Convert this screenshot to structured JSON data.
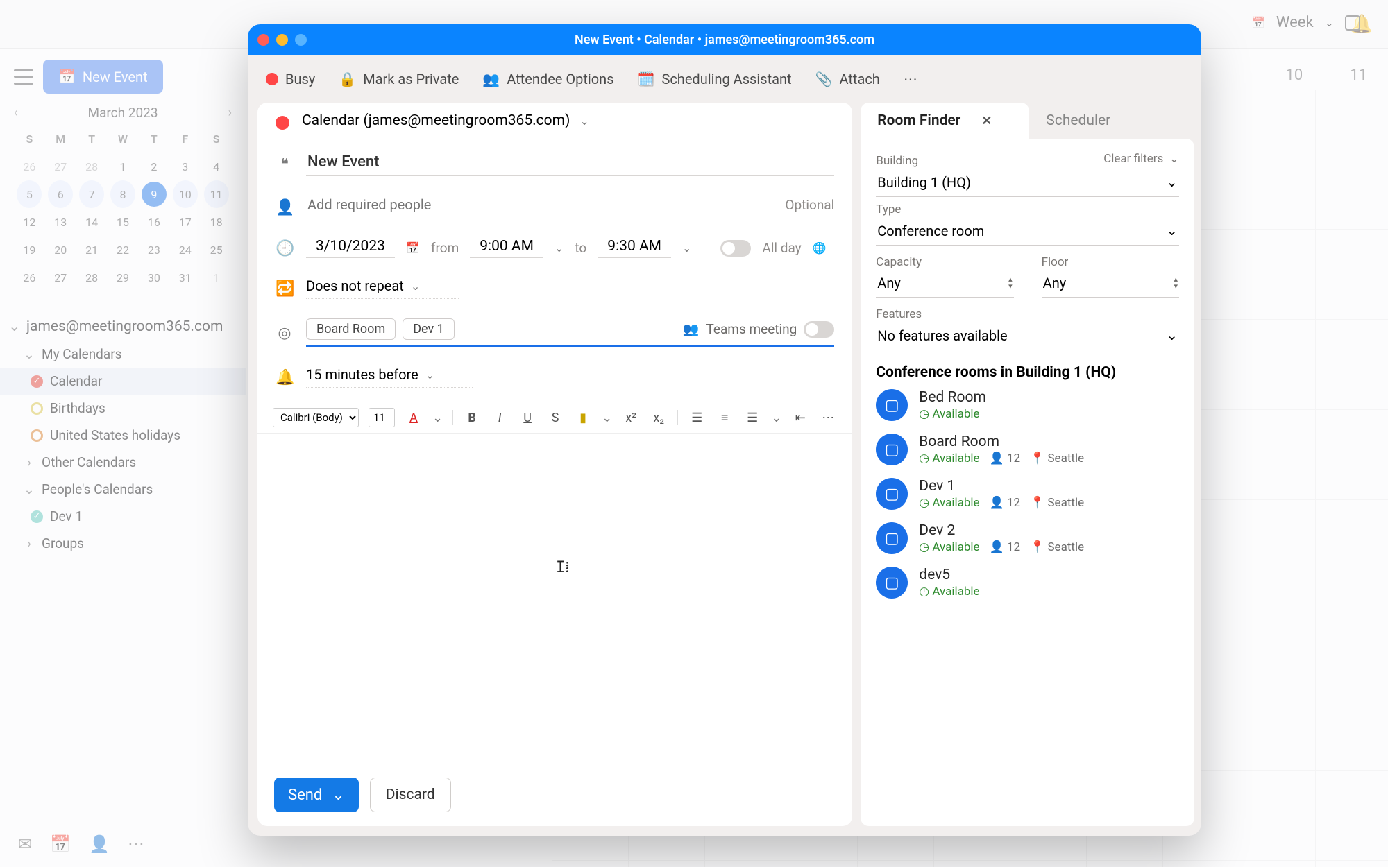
{
  "accent_color": "#1a6fe8",
  "bg_header": {
    "view_label": "Week"
  },
  "sidebar": {
    "new_event": "New Event",
    "month_title": "March 2023",
    "dows": [
      "S",
      "M",
      "T",
      "W",
      "T",
      "F",
      "S"
    ],
    "cells": [
      {
        "v": "26",
        "m": true
      },
      {
        "v": "27",
        "m": true
      },
      {
        "v": "28",
        "m": true
      },
      {
        "v": "1"
      },
      {
        "v": "2"
      },
      {
        "v": "3"
      },
      {
        "v": "4"
      },
      {
        "v": "5",
        "w": true
      },
      {
        "v": "6",
        "w": true
      },
      {
        "v": "7",
        "w": true
      },
      {
        "v": "8",
        "w": true
      },
      {
        "v": "9",
        "t": true
      },
      {
        "v": "10",
        "w": true
      },
      {
        "v": "11",
        "w": true
      },
      {
        "v": "12"
      },
      {
        "v": "13"
      },
      {
        "v": "14"
      },
      {
        "v": "15"
      },
      {
        "v": "16"
      },
      {
        "v": "17"
      },
      {
        "v": "18"
      },
      {
        "v": "19"
      },
      {
        "v": "20"
      },
      {
        "v": "21"
      },
      {
        "v": "22"
      },
      {
        "v": "23"
      },
      {
        "v": "24"
      },
      {
        "v": "25"
      },
      {
        "v": "26"
      },
      {
        "v": "27"
      },
      {
        "v": "28"
      },
      {
        "v": "29"
      },
      {
        "v": "30"
      },
      {
        "v": "31"
      },
      {
        "v": "1",
        "m": true
      }
    ],
    "account": "james@meetingroom365.com",
    "my_calendars_label": "My Calendars",
    "my_calendars": [
      {
        "name": "Calendar",
        "color": "#e0352b",
        "active": true,
        "check": true
      },
      {
        "name": "Birthdays",
        "ring": "#d7c23a"
      },
      {
        "name": "United States holidays",
        "ring": "#d97b1f"
      }
    ],
    "other_label": "Other Calendars",
    "people_label": "People's Calendars",
    "people": [
      {
        "name": "Dev 1",
        "color": "#57c5b8",
        "check": true
      }
    ],
    "groups_label": "Groups"
  },
  "grid_days": [
    "10",
    "11"
  ],
  "modal": {
    "title": "New Event • Calendar • james@meetingroom365.com",
    "toolbar": {
      "busy": "Busy",
      "private": "Mark as Private",
      "attendee_options": "Attendee Options",
      "scheduling_assistant": "Scheduling Assistant",
      "attach": "Attach"
    },
    "calendar_line": "Calendar (james@meetingroom365.com)",
    "event_title": "New Event",
    "people_placeholder": "Add required people",
    "optional_label": "Optional",
    "date": "3/10/2023",
    "from_label": "from",
    "from_time": "9:00 AM",
    "to_label": "to",
    "to_time": "9:30 AM",
    "allday_label": "All day",
    "repeat": "Does not repeat",
    "locations": [
      "Board Room",
      "Dev 1"
    ],
    "teams_label": "Teams meeting",
    "reminder": "15 minutes before",
    "font_name": "Calibri (Body)",
    "font_size": "11",
    "send": "Send",
    "discard": "Discard"
  },
  "roomfinder": {
    "tab_room": "Room Finder",
    "tab_sched": "Scheduler",
    "building_label": "Building",
    "clear": "Clear filters",
    "building": "Building 1 (HQ)",
    "type_label": "Type",
    "type": "Conference room",
    "capacity_label": "Capacity",
    "capacity": "Any",
    "floor_label": "Floor",
    "floor": "Any",
    "features_label": "Features",
    "features": "No features available",
    "list_title": "Conference rooms in Building 1 (HQ)",
    "available_word": "Available",
    "rooms": [
      {
        "name": "Bed Room",
        "available": true
      },
      {
        "name": "Board Room",
        "available": true,
        "cap": "12",
        "city": "Seattle"
      },
      {
        "name": "Dev 1",
        "available": true,
        "cap": "12",
        "city": "Seattle"
      },
      {
        "name": "Dev 2",
        "available": true,
        "cap": "12",
        "city": "Seattle"
      },
      {
        "name": "dev5",
        "available": true
      }
    ]
  }
}
